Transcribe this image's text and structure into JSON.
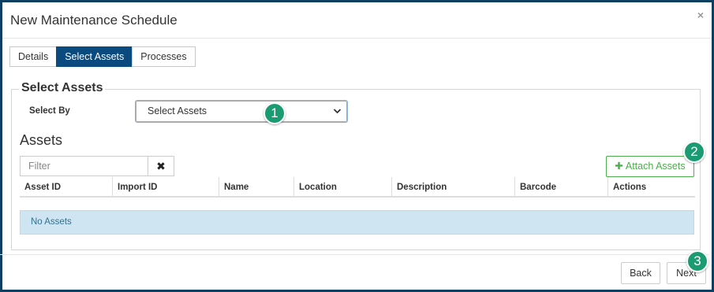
{
  "modal": {
    "title": "New Maintenance Schedule",
    "close_glyph": "×"
  },
  "tabs": [
    {
      "label": "Details",
      "active": false
    },
    {
      "label": "Select Assets",
      "active": true
    },
    {
      "label": "Processes",
      "active": false
    }
  ],
  "select_section": {
    "legend": "Select Assets",
    "select_by_label": "Select By",
    "select_value": "Select Assets"
  },
  "assets": {
    "title": "Assets",
    "filter_placeholder": "Filter",
    "clear_glyph": "✖",
    "attach_button": "Attach Assets",
    "columns": [
      "Asset ID",
      "Import ID",
      "Name",
      "Location",
      "Description",
      "Barcode",
      "Actions"
    ],
    "empty_message": "No Assets"
  },
  "footer": {
    "back_label": "Back",
    "next_label": "Next"
  },
  "callouts": [
    "1",
    "2",
    "3"
  ],
  "colors": {
    "primary": "#0b4a7e",
    "success": "#4cae4c",
    "info_bg": "#cfe6f2",
    "callout": "#1b9b72",
    "frame": "#0d3f63"
  }
}
